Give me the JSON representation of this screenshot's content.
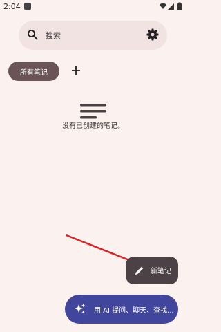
{
  "status_bar": {
    "time": "2:04",
    "icons": [
      "notification-square-icon",
      "wifi-icon",
      "signal-icon",
      "battery-icon"
    ]
  },
  "search": {
    "placeholder": "搜索",
    "leading_icon": "search-icon",
    "trailing_icon": "gear-icon"
  },
  "folders": {
    "chips": [
      {
        "label": "所有笔记",
        "selected": true
      }
    ],
    "add_icon": "plus-icon"
  },
  "empty_state": {
    "icon": "lines-icon",
    "message": "没有已创建的笔记。"
  },
  "fab": {
    "label": "新笔记",
    "icon": "pen-icon"
  },
  "ai_assistant": {
    "label": "用 AI 提问、聊天、查找...",
    "icon": "sparkle-icon"
  },
  "colors": {
    "background": "#fbf2f0",
    "search_bg": "#f0e3e2",
    "chip_selected": "#6a5457",
    "fab_bg": "#4c4246",
    "ai_bg": "#41469c",
    "annotation_arrow": "#e02020"
  }
}
